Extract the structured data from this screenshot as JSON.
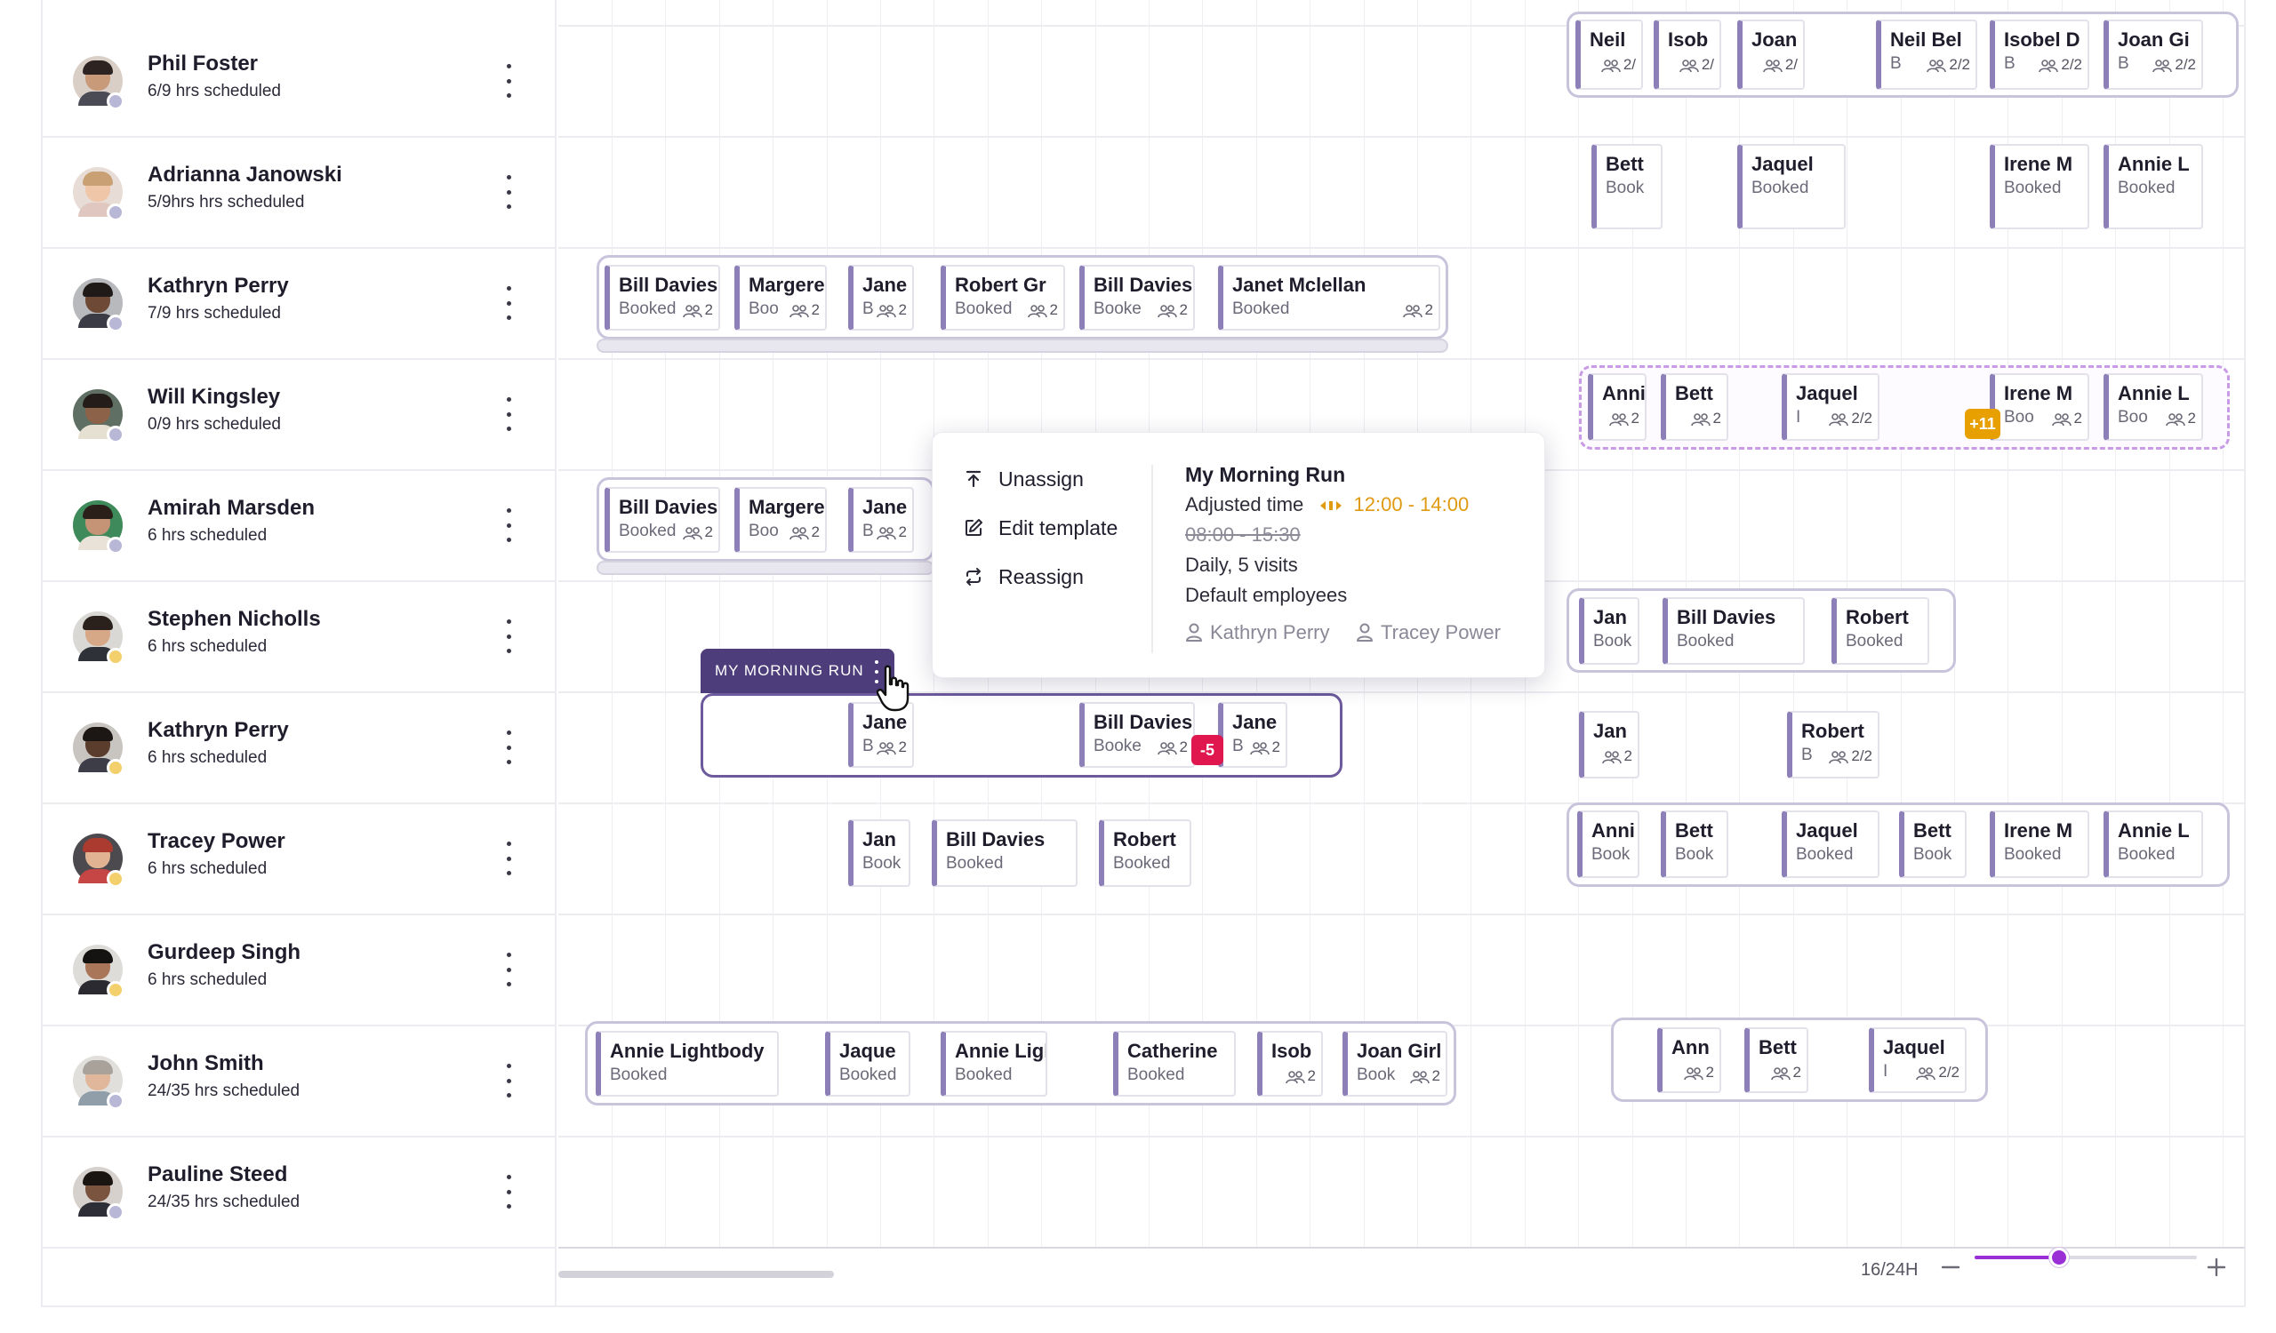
{
  "colors": {
    "accent": "#9b2fd6",
    "run_label_bg": "#4d3d7a",
    "card_stripe": "#8d80b8",
    "adjusted_time": "#e09a12",
    "overflow_badge": "#e8a000",
    "negative_badge": "#e0164f",
    "status_away": "#b9b7d6",
    "status_busy": "#f3d06b"
  },
  "employees": [
    {
      "name": "Phil Foster",
      "hours": "6/9 hrs scheduled",
      "status": "away"
    },
    {
      "name": "Adrianna Janowski",
      "hours": "5/9hrs hrs scheduled",
      "status": "away"
    },
    {
      "name": "Kathryn Perry",
      "hours": "7/9 hrs scheduled",
      "status": "away"
    },
    {
      "name": "Will Kingsley",
      "hours": "0/9 hrs scheduled",
      "status": "away"
    },
    {
      "name": "Amirah Marsden",
      "hours": "6 hrs scheduled",
      "status": "away"
    },
    {
      "name": "Stephen Nicholls",
      "hours": "6 hrs scheduled",
      "status": "busy"
    },
    {
      "name": "Kathryn Perry",
      "hours": "6 hrs scheduled",
      "status": "busy"
    },
    {
      "name": "Tracey Power",
      "hours": "6 hrs scheduled",
      "status": "busy"
    },
    {
      "name": "Gurdeep Singh",
      "hours": "6 hrs scheduled",
      "status": "busy"
    },
    {
      "name": "John Smith",
      "hours": "24/35 hrs scheduled",
      "status": "away"
    },
    {
      "name": "Pauline Steed",
      "hours": "24/35 hrs scheduled",
      "status": "away"
    }
  ],
  "visits": [
    {
      "name": "Neil",
      "status": "",
      "count": "2/"
    },
    {
      "name": "Isob",
      "status": "",
      "count": "2/"
    },
    {
      "name": "Joan",
      "status": "",
      "count": "2/"
    },
    {
      "name": "Neil Bel",
      "status": "B",
      "count": "2/2"
    },
    {
      "name": "Isobel D",
      "status": "B",
      "count": "2/2"
    },
    {
      "name": "Joan Gi",
      "status": "B",
      "count": "2/2"
    },
    {
      "name": "Bett",
      "status": "Book",
      "count": ""
    },
    {
      "name": "Jaquel",
      "status": "Booked",
      "count": ""
    },
    {
      "name": "Irene M",
      "status": "Booked",
      "count": ""
    },
    {
      "name": "Annie L",
      "status": "Booked",
      "count": ""
    },
    {
      "name": "Bill Davies",
      "status": "Booked",
      "count": "2"
    },
    {
      "name": "Margere",
      "status": "Boo",
      "count": "2"
    },
    {
      "name": "Jane",
      "status": "B",
      "count": "2"
    },
    {
      "name": "Robert Gr",
      "status": "Booked",
      "count": "2"
    },
    {
      "name": "Bill Davies",
      "status": "Booke",
      "count": "2"
    },
    {
      "name": "Janet Mclellan",
      "status": "Booked",
      "count": "2"
    },
    {
      "name": "Anni",
      "status": "",
      "count": "2"
    },
    {
      "name": "Bett",
      "status": "",
      "count": "2"
    },
    {
      "name": "Jaquel",
      "status": "I",
      "count": "2/2"
    },
    {
      "name": "Irene M",
      "status": "Boo",
      "count": "2"
    },
    {
      "name": "Annie L",
      "status": "Boo",
      "count": "2"
    },
    {
      "name": "Bill Davies",
      "status": "Booked",
      "count": "2"
    },
    {
      "name": "Margere",
      "status": "Boo",
      "count": "2"
    },
    {
      "name": "Jane",
      "status": "B",
      "count": "2"
    },
    {
      "name": "Jan",
      "status": "Book",
      "count": ""
    },
    {
      "name": "Bill Davies",
      "status": "Booked",
      "count": ""
    },
    {
      "name": "Robert",
      "status": "Booked",
      "count": ""
    },
    {
      "name": "Jane",
      "status": "B",
      "count": "2"
    },
    {
      "name": "Bill Davies",
      "status": "Booke",
      "count": "2"
    },
    {
      "name": "Jane",
      "status": "B",
      "count": "2"
    },
    {
      "name": "Jan",
      "status": "",
      "count": "2"
    },
    {
      "name": "Robert",
      "status": "B",
      "count": "2/2"
    },
    {
      "name": "Jan",
      "status": "Book",
      "count": ""
    },
    {
      "name": "Bill Davies",
      "status": "Booked",
      "count": ""
    },
    {
      "name": "Robert",
      "status": "Booked",
      "count": ""
    },
    {
      "name": "Anni",
      "status": "Book",
      "count": ""
    },
    {
      "name": "Bett",
      "status": "Book",
      "count": ""
    },
    {
      "name": "Jaquel",
      "status": "Booked",
      "count": ""
    },
    {
      "name": "Bett",
      "status": "Book",
      "count": ""
    },
    {
      "name": "Irene M",
      "status": "Booked",
      "count": ""
    },
    {
      "name": "Annie L",
      "status": "Booked",
      "count": ""
    },
    {
      "name": "Annie Lightbody",
      "status": "Booked",
      "count": ""
    },
    {
      "name": "Jaque",
      "status": "Booked",
      "count": ""
    },
    {
      "name": "Annie Ligh",
      "status": "Booked",
      "count": ""
    },
    {
      "name": "Catherine",
      "status": "Booked",
      "count": ""
    },
    {
      "name": "Isob",
      "status": "",
      "count": "2"
    },
    {
      "name": "Joan Girl",
      "status": "Book",
      "count": "2"
    },
    {
      "name": "Ann",
      "status": "",
      "count": "2"
    },
    {
      "name": "Bett",
      "status": "",
      "count": "2"
    },
    {
      "name": "Jaquel",
      "status": "I",
      "count": "2/2"
    }
  ],
  "badges": {
    "overflow": "+11",
    "negative": "-5"
  },
  "run_label": "MY MORNING RUN",
  "popup": {
    "actions": [
      {
        "label": "Unassign",
        "icon": "unassign-icon"
      },
      {
        "label": "Edit template",
        "icon": "edit-icon"
      },
      {
        "label": "Reassign",
        "icon": "reassign-icon"
      }
    ],
    "title": "My Morning Run",
    "adjusted_label": "Adjusted time",
    "adjusted_time": "12:00 - 14:00",
    "original_time": "08:00 - 15:30",
    "frequency": "Daily, 5 visits",
    "default_label": "Default employees",
    "default_employees": [
      "Kathryn Perry",
      "Tracey Power"
    ]
  },
  "zoom": {
    "label": "16/24H",
    "level": 0.38
  }
}
